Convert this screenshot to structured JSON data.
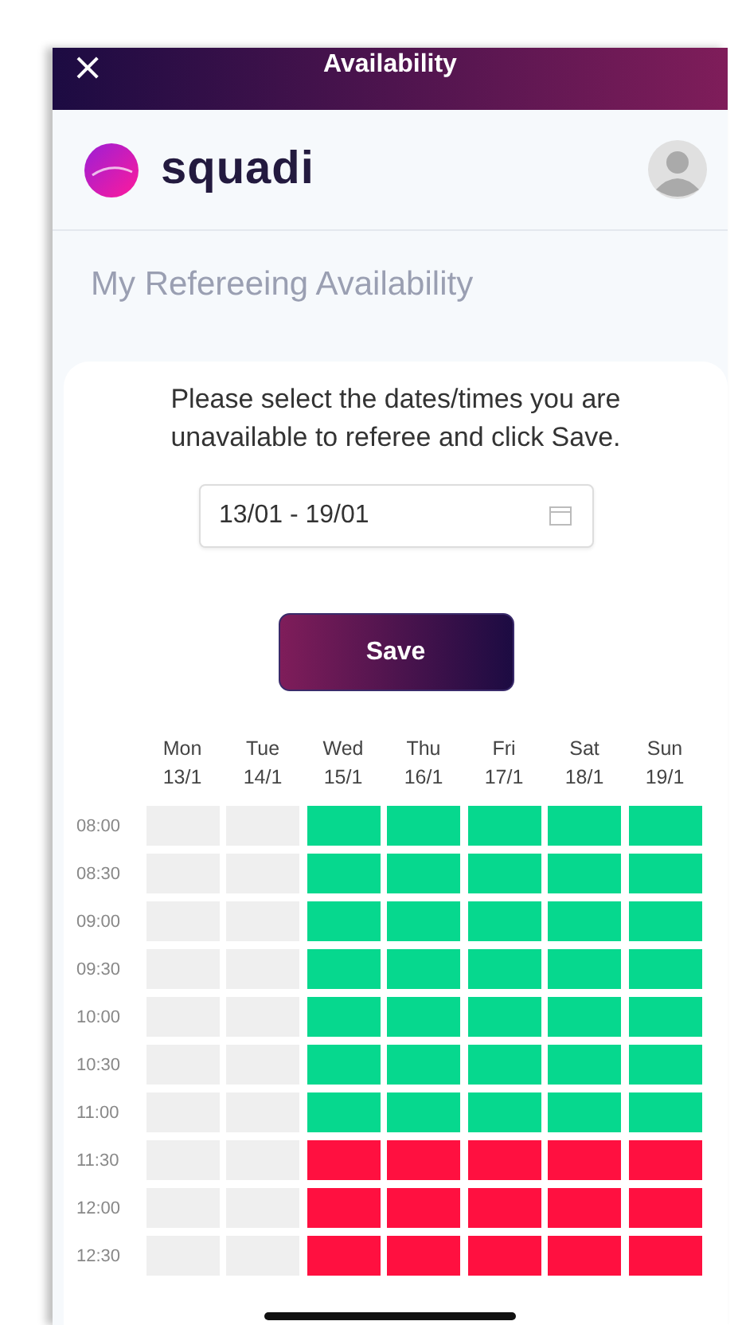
{
  "top_bar": {
    "close_label": "×",
    "title": "Availability"
  },
  "header": {
    "logo_text": "squadi"
  },
  "page_title": "My Refereeing Availability",
  "instructions": "Please select the dates/times you are unavailable to referee and click Save.",
  "date_range": {
    "value": "13/01 - 19/01"
  },
  "save_button": "Save",
  "days": [
    {
      "day": "Mon",
      "date": "13/1"
    },
    {
      "day": "Tue",
      "date": "14/1"
    },
    {
      "day": "Wed",
      "date": "15/1"
    },
    {
      "day": "Thu",
      "date": "16/1"
    },
    {
      "day": "Fri",
      "date": "17/1"
    },
    {
      "day": "Sat",
      "date": "18/1"
    },
    {
      "day": "Sun",
      "date": "19/1"
    }
  ],
  "rows": [
    {
      "time": "08:00",
      "slots": [
        {
          "disabled": true,
          "selected": false
        },
        {
          "disabled": true,
          "selected": false
        },
        {
          "disabled": false,
          "selected": false
        },
        {
          "disabled": false,
          "selected": false
        },
        {
          "disabled": false,
          "selected": false
        },
        {
          "disabled": false,
          "selected": false
        },
        {
          "disabled": false,
          "selected": false
        }
      ]
    },
    {
      "time": "08:30",
      "slots": [
        {
          "disabled": true,
          "selected": false
        },
        {
          "disabled": true,
          "selected": false
        },
        {
          "disabled": false,
          "selected": false
        },
        {
          "disabled": false,
          "selected": false
        },
        {
          "disabled": false,
          "selected": false
        },
        {
          "disabled": false,
          "selected": false
        },
        {
          "disabled": false,
          "selected": false
        }
      ]
    },
    {
      "time": "09:00",
      "slots": [
        {
          "disabled": true,
          "selected": false
        },
        {
          "disabled": true,
          "selected": false
        },
        {
          "disabled": false,
          "selected": false
        },
        {
          "disabled": false,
          "selected": false
        },
        {
          "disabled": false,
          "selected": false
        },
        {
          "disabled": false,
          "selected": false
        },
        {
          "disabled": false,
          "selected": false
        }
      ]
    },
    {
      "time": "09:30",
      "slots": [
        {
          "disabled": true,
          "selected": false
        },
        {
          "disabled": true,
          "selected": false
        },
        {
          "disabled": false,
          "selected": false
        },
        {
          "disabled": false,
          "selected": false
        },
        {
          "disabled": false,
          "selected": false
        },
        {
          "disabled": false,
          "selected": false
        },
        {
          "disabled": false,
          "selected": false
        }
      ]
    },
    {
      "time": "10:00",
      "slots": [
        {
          "disabled": true,
          "selected": false
        },
        {
          "disabled": true,
          "selected": false
        },
        {
          "disabled": false,
          "selected": false
        },
        {
          "disabled": false,
          "selected": false
        },
        {
          "disabled": false,
          "selected": false
        },
        {
          "disabled": false,
          "selected": false
        },
        {
          "disabled": false,
          "selected": false
        }
      ]
    },
    {
      "time": "10:30",
      "slots": [
        {
          "disabled": true,
          "selected": false
        },
        {
          "disabled": true,
          "selected": false
        },
        {
          "disabled": false,
          "selected": false
        },
        {
          "disabled": false,
          "selected": false
        },
        {
          "disabled": false,
          "selected": false
        },
        {
          "disabled": false,
          "selected": false
        },
        {
          "disabled": false,
          "selected": false
        }
      ]
    },
    {
      "time": "11:00",
      "slots": [
        {
          "disabled": true,
          "selected": false
        },
        {
          "disabled": true,
          "selected": false
        },
        {
          "disabled": false,
          "selected": false
        },
        {
          "disabled": false,
          "selected": false
        },
        {
          "disabled": false,
          "selected": false
        },
        {
          "disabled": false,
          "selected": false
        },
        {
          "disabled": false,
          "selected": false
        }
      ]
    },
    {
      "time": "11:30",
      "slots": [
        {
          "disabled": true,
          "selected": false
        },
        {
          "disabled": true,
          "selected": false
        },
        {
          "disabled": false,
          "selected": true
        },
        {
          "disabled": false,
          "selected": true
        },
        {
          "disabled": false,
          "selected": true
        },
        {
          "disabled": false,
          "selected": true
        },
        {
          "disabled": false,
          "selected": true
        }
      ]
    },
    {
      "time": "12:00",
      "slots": [
        {
          "disabled": true,
          "selected": false
        },
        {
          "disabled": true,
          "selected": false
        },
        {
          "disabled": false,
          "selected": true
        },
        {
          "disabled": false,
          "selected": true
        },
        {
          "disabled": false,
          "selected": true
        },
        {
          "disabled": false,
          "selected": true
        },
        {
          "disabled": false,
          "selected": true
        }
      ]
    },
    {
      "time": "12:30",
      "slots": [
        {
          "disabled": true,
          "selected": false
        },
        {
          "disabled": true,
          "selected": false
        },
        {
          "disabled": false,
          "selected": true
        },
        {
          "disabled": false,
          "selected": true
        },
        {
          "disabled": false,
          "selected": true
        },
        {
          "disabled": false,
          "selected": true
        },
        {
          "disabled": false,
          "selected": true
        }
      ]
    }
  ]
}
